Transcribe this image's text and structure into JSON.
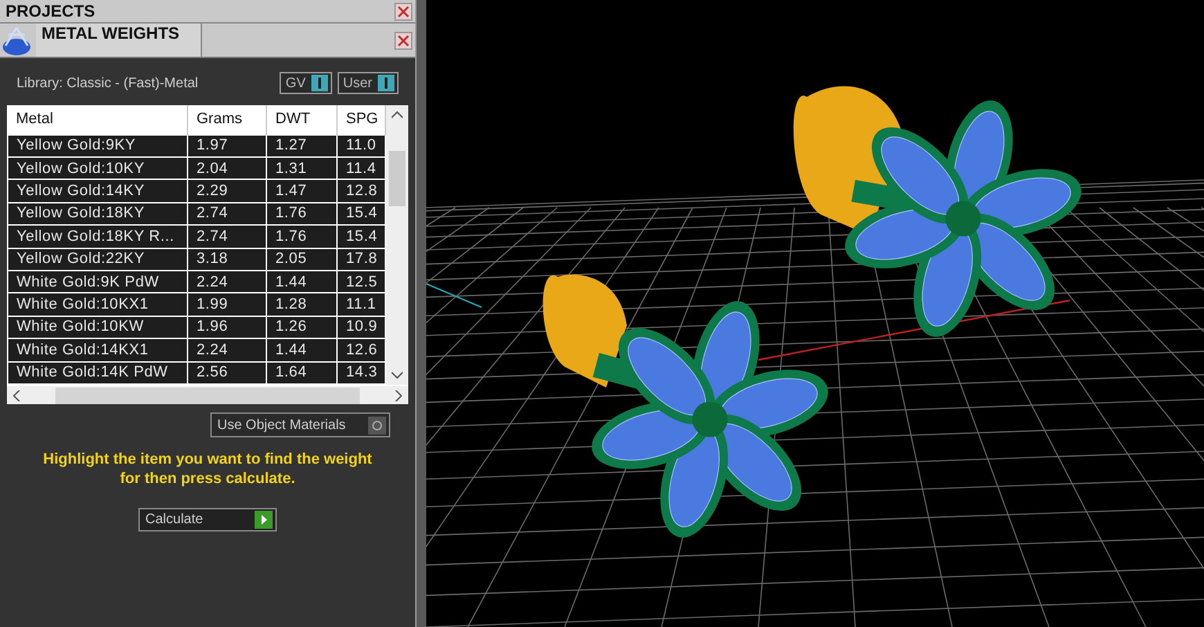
{
  "top_bar": {
    "title": "PROJECTS"
  },
  "panel": {
    "title": "METAL WEIGHTS",
    "library": "Library: Classic - (Fast)-Metal",
    "toggles": [
      {
        "label": "GV",
        "on": true
      },
      {
        "label": "User",
        "on": true
      }
    ],
    "table": {
      "columns": [
        "Metal",
        "Grams",
        "DWT",
        "SPG"
      ],
      "rows": [
        [
          "Yellow Gold:9KY",
          "1.97",
          "1.27",
          "11.0"
        ],
        [
          "Yellow Gold:10KY",
          "2.04",
          "1.31",
          "11.4"
        ],
        [
          "Yellow Gold:14KY",
          "2.29",
          "1.47",
          "12.8"
        ],
        [
          "Yellow Gold:18KY",
          "2.74",
          "1.76",
          "15.4"
        ],
        [
          "Yellow Gold:18KY R...",
          "2.74",
          "1.76",
          "15.4"
        ],
        [
          "Yellow Gold:22KY",
          "3.18",
          "2.05",
          "17.8"
        ],
        [
          "White Gold:9K PdW",
          "2.24",
          "1.44",
          "12.5"
        ],
        [
          "White Gold:10KX1",
          "1.99",
          "1.28",
          "11.1"
        ],
        [
          "White Gold:10KW",
          "1.96",
          "1.26",
          "10.9"
        ],
        [
          "White Gold:14KX1",
          "2.24",
          "1.44",
          "12.6"
        ],
        [
          "White Gold:14K PdW",
          "2.56",
          "1.64",
          "14.3"
        ]
      ]
    },
    "use_object_materials": {
      "label": "Use Object Materials",
      "on": false
    },
    "instruction": "Highlight the item you want to find the weight for then press calculate.",
    "calculate_button": "Calculate"
  }
}
